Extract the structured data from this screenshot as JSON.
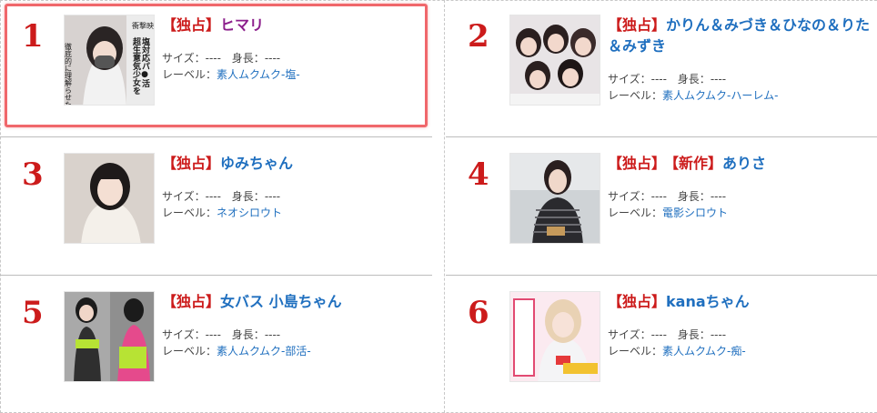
{
  "items": [
    {
      "rank": "1",
      "tag": "【独占】",
      "tag2": "",
      "name": "ヒマリ",
      "size_label": "サイズ：",
      "size_value": "----",
      "height_label": "身長：",
      "height_value": "----",
      "label_label": "レーベル：",
      "label_value": "素人ムクムク-塩-",
      "thumb_caption_1": "衝撃映像",
      "thumb_caption_2": "塩対応パ●活",
      "thumb_caption_3": "超生意気少女を",
      "thumb_caption_4": "徹底的に理解らせた!"
    },
    {
      "rank": "2",
      "tag": "【独占】",
      "tag2": "",
      "name": "かりん＆みづき＆ひなの＆りた＆みずき",
      "size_label": "サイズ：",
      "size_value": "----",
      "height_label": "身長：",
      "height_value": "----",
      "label_label": "レーベル：",
      "label_value": "素人ムクムク-ハーレム-"
    },
    {
      "rank": "3",
      "tag": "【独占】",
      "tag2": "",
      "name": "ゆみちゃん",
      "size_label": "サイズ：",
      "size_value": "----",
      "height_label": "身長：",
      "height_value": "----",
      "label_label": "レーベル：",
      "label_value": "ネオシロウト"
    },
    {
      "rank": "4",
      "tag": "【独占】",
      "tag2": "【新作】",
      "name": "ありさ",
      "size_label": "サイズ：",
      "size_value": "----",
      "height_label": "身長：",
      "height_value": "----",
      "label_label": "レーベル：",
      "label_value": "電影シロウト"
    },
    {
      "rank": "5",
      "tag": "【独占】",
      "tag2": "",
      "name": "女バス 小島ちゃん",
      "size_label": "サイズ：",
      "size_value": "----",
      "height_label": "身長：",
      "height_value": "----",
      "label_label": "レーベル：",
      "label_value": "素人ムクムク-部活-"
    },
    {
      "rank": "6",
      "tag": "【独占】",
      "tag2": "",
      "name": "kanaちゃん",
      "size_label": "サイズ：",
      "size_value": "----",
      "height_label": "身長：",
      "height_value": "----",
      "label_label": "レーベル：",
      "label_value": "素人ムクムク-痴-"
    }
  ],
  "colors": {
    "rank": "#cc1b1b",
    "link": "#1f6fbf",
    "highlight_border": "#f0676b",
    "name_purple": "#8b1e8b"
  }
}
